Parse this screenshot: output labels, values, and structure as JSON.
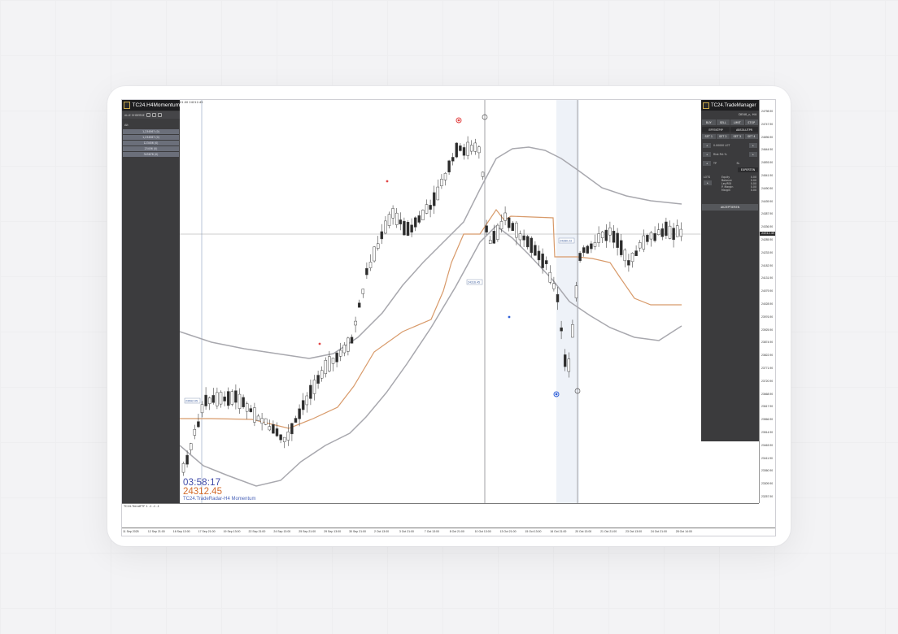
{
  "window": {
    "top_readout": "01.00  24212.45"
  },
  "left_panel": {
    "title": "TC24.H4Momentum",
    "toolbar_label": "ALLE OHDERNE",
    "section_label": "Alt",
    "rows": [
      "1,234567 (0)",
      "1,234567 (0)",
      "123456 (0)",
      "23456 (0)",
      "345678 (0)"
    ]
  },
  "chart": {
    "countdown": "03:58:17",
    "price": "24312.45",
    "indicator_name": "TC24.TradeRadar-H4 Momentum",
    "left_box": "23592.05",
    "mid_box": "24316.45",
    "right_box": "24280.23"
  },
  "price_axis": {
    "ticks": [
      "24798.90",
      "24747.90",
      "24696.90",
      "24644.90",
      "24593.90",
      "24541.90",
      "24490.90",
      "24439.90",
      "24387.90",
      "24336.90",
      "24285.90",
      "24233.90",
      "24182.90",
      "24131.90",
      "24079.90",
      "24028.90",
      "23976.90",
      "23925.90",
      "23874.90",
      "23822.90",
      "23771.90",
      "23720.90",
      "23668.90",
      "23617.90",
      "23566.90",
      "23514.90",
      "23463.90",
      "23411.90",
      "23360.90",
      "23309.90",
      "23257.90"
    ],
    "current": "24312.45"
  },
  "trade_manager": {
    "title": "TC24.TradeManager",
    "symbol": "DE40_c, H4",
    "order_buttons": [
      "BUY",
      "SELL",
      "LIMIT",
      "STOP"
    ],
    "mode_buttons": [
      "EFFEKTPIP",
      "ABSOLUTPR"
    ],
    "set_buttons": [
      "SET 1",
      "SET 2",
      "SET 3",
      "SET 4"
    ],
    "fields": [
      "0.00000 LOT",
      "Risk Pct %",
      "TP",
      "SL"
    ],
    "info_labels": [
      "LOTS",
      "Equity",
      "Balance",
      "Lev/ROI",
      "P. Margin",
      "Margin"
    ],
    "info_values": [
      "0.00",
      "0.00",
      "0.00",
      "0.00",
      "0.00"
    ],
    "expert_button": "EXPERTEN",
    "bottom_button": "AKZEPTIEREN"
  },
  "sub_pane": {
    "label": "TC24.TrendFTF  1  -1  -1  -1"
  },
  "time_axis": {
    "ticks": [
      "11 Sep 2025",
      "12 Sep 21:00",
      "16 Sep 13:00",
      "17 Sep 21:00",
      "19 Sep 13:00",
      "22 Sep 21:00",
      "24 Sep 13:00",
      "25 Sep 21:00",
      "29 Sep 13:00",
      "30 Sep 21:00",
      "2 Oct 13:00",
      "3 Oct 21:00",
      "7 Oct 13:00",
      "8 Oct 21:00",
      "10 Oct 13:00",
      "13 Oct 21:00",
      "15 Oct 13:00",
      "16 Oct 21:00",
      "20 Oct 13:00",
      "21 Oct 21:00",
      "23 Oct 13:00",
      "24 Oct 21:00",
      "28 Oct 14:00"
    ]
  },
  "colors": {
    "up_candle": "#ffffff",
    "down_candle": "#2b2b2b",
    "band": "#a8a8ae",
    "trail": "#d89a6a",
    "dot_red": "#e24646",
    "dot_green": "#3a9a6a",
    "dot_blue": "#3060d8"
  }
}
